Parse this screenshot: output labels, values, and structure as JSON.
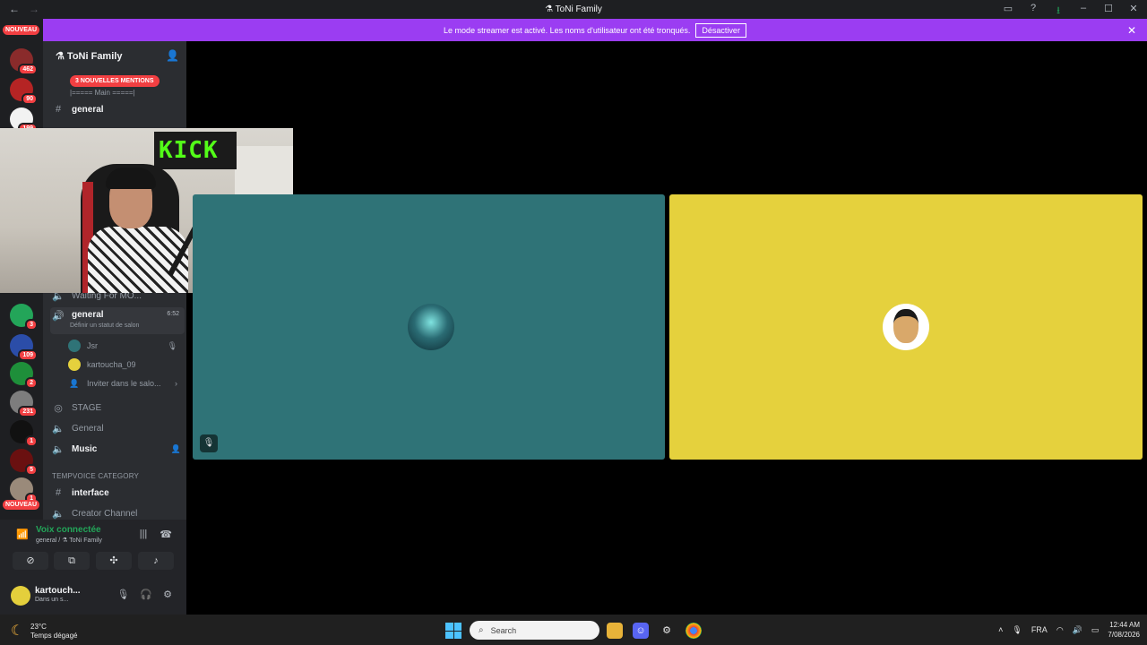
{
  "window": {
    "title": "⚗ ToNi Family"
  },
  "banner": {
    "message": "Le mode streamer est activé. Les noms d'utilisateur ont été tronqués.",
    "button": "Désactiver"
  },
  "rail": {
    "new_top": "NOUVEAU",
    "new_bottom": "NOUVEAU",
    "badges": [
      "462",
      "90",
      "199",
      "3",
      "109",
      "2",
      "231",
      "1",
      "5",
      "1"
    ]
  },
  "server": {
    "name": "⚗ ToNi Family"
  },
  "mentions": "3 NOUVELLES MENTIONS",
  "channels": {
    "main_sep": "|===== Main =====|",
    "general_text": "general",
    "waiting": "Waiting For MO...",
    "general_voice": "general",
    "general_voice_time": "6:52",
    "status_hint": "Définir un statut de salon",
    "users": [
      "Jsr",
      "kartoucha_09"
    ],
    "invite": "Inviter dans le salo...",
    "stage": "STAGE",
    "general2": "General",
    "music": "Music",
    "category": "TEMPVOICE CATEGORY",
    "interface": "interface",
    "creator": "Creator Channel"
  },
  "webcam": {
    "sign": "KICK"
  },
  "voice": {
    "status": "Voix connectée",
    "location": "general / ⚗ ToNi Family"
  },
  "me": {
    "name": "kartouch...",
    "status": "Dans un s..."
  },
  "taskbar": {
    "temp": "23°C",
    "weather": "Temps dégagé",
    "search": "Search",
    "lang": "FRA",
    "time": "12:44 AM",
    "date": "7/08/2026"
  },
  "colors": {
    "blurple": "#5865f2",
    "banner": "#9b3df2",
    "tile_teal": "#2f7377",
    "tile_yellow": "#e5d13d",
    "red": "#f23f42",
    "green": "#23a559"
  }
}
